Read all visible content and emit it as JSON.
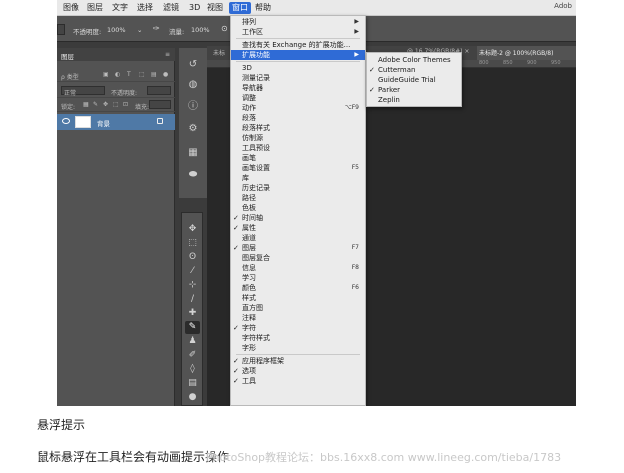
{
  "menubar": {
    "items": [
      "图像",
      "图层",
      "文字",
      "选择",
      "滤镜",
      "3D",
      "视图",
      "窗口",
      "帮助"
    ],
    "active_index": 7,
    "app_name": "Adob"
  },
  "options_bar": {
    "opacity_label": "不透明度:",
    "opacity_value": "100%",
    "flow_label": "流量:",
    "flow_value": "100%"
  },
  "layers_panel": {
    "tab": "图层",
    "filter_label": "ρ 类型",
    "blend_mode": "正常",
    "opacity_label": "不透明度:",
    "lock_label": "锁定:",
    "fill_label": "填充:",
    "layer_name": "背景"
  },
  "document_tabs": {
    "left_tab": "未标",
    "mid_tab": "@ 16.7%(RGB/8#) ×",
    "active_tab": "未标题-2 @ 100%(RGB/8)",
    "ruler_numbers": [
      "800",
      "850",
      "900",
      "950"
    ]
  },
  "window_menu": {
    "items": [
      {
        "label": "排列",
        "arrow": true
      },
      {
        "label": "工作区",
        "arrow": true
      },
      {
        "sep": true
      },
      {
        "label": "查找有关 Exchange 的扩展功能..."
      },
      {
        "label": "扩展功能",
        "arrow": true,
        "highlight": true
      },
      {
        "sep": true
      },
      {
        "label": "3D"
      },
      {
        "label": "测量记录"
      },
      {
        "label": "导航器"
      },
      {
        "label": "调整"
      },
      {
        "label": "动作",
        "shortcut": "⌥F9"
      },
      {
        "label": "段落"
      },
      {
        "label": "段落样式"
      },
      {
        "label": "仿制源"
      },
      {
        "label": "工具预设"
      },
      {
        "label": "画笔"
      },
      {
        "label": "画笔设置",
        "shortcut": "F5"
      },
      {
        "label": "库"
      },
      {
        "label": "历史记录"
      },
      {
        "label": "路径"
      },
      {
        "label": "色板"
      },
      {
        "label": "时间轴",
        "checked": true
      },
      {
        "label": "属性",
        "checked": true
      },
      {
        "label": "通道"
      },
      {
        "label": "图层",
        "checked": true,
        "shortcut": "F7"
      },
      {
        "label": "图层复合"
      },
      {
        "label": "信息",
        "shortcut": "F8"
      },
      {
        "label": "学习"
      },
      {
        "label": "颜色",
        "shortcut": "F6"
      },
      {
        "label": "样式"
      },
      {
        "label": "直方图"
      },
      {
        "label": "注释"
      },
      {
        "label": "字符",
        "checked": true
      },
      {
        "label": "字符样式"
      },
      {
        "label": "字形"
      },
      {
        "sep": true
      },
      {
        "label": "应用程序框架",
        "checked": true
      },
      {
        "label": "选项",
        "checked": true
      },
      {
        "label": "工具",
        "checked": true
      }
    ]
  },
  "extensions_submenu": {
    "items": [
      {
        "label": "Adobe Color Themes"
      },
      {
        "label": "Cutterman",
        "checked": true
      },
      {
        "label": "GuideGuide Trial"
      },
      {
        "label": "Parker",
        "checked": true
      },
      {
        "label": "Zeplin"
      }
    ]
  },
  "caption": {
    "title": "悬浮提示",
    "body": "鼠标悬浮在工具栏会有动画提示操作",
    "watermark": "PhotoShop教程论坛：bbs.16xx8.com www.lineeg.com/tieba/1783"
  },
  "icons": {
    "check": "✓",
    "arrow": "▶"
  },
  "colors": {
    "highlight": "#2f6bd6",
    "menu_bg": "#ebebeb",
    "panel_bg": "#535353",
    "canvas_bg": "#282828"
  }
}
